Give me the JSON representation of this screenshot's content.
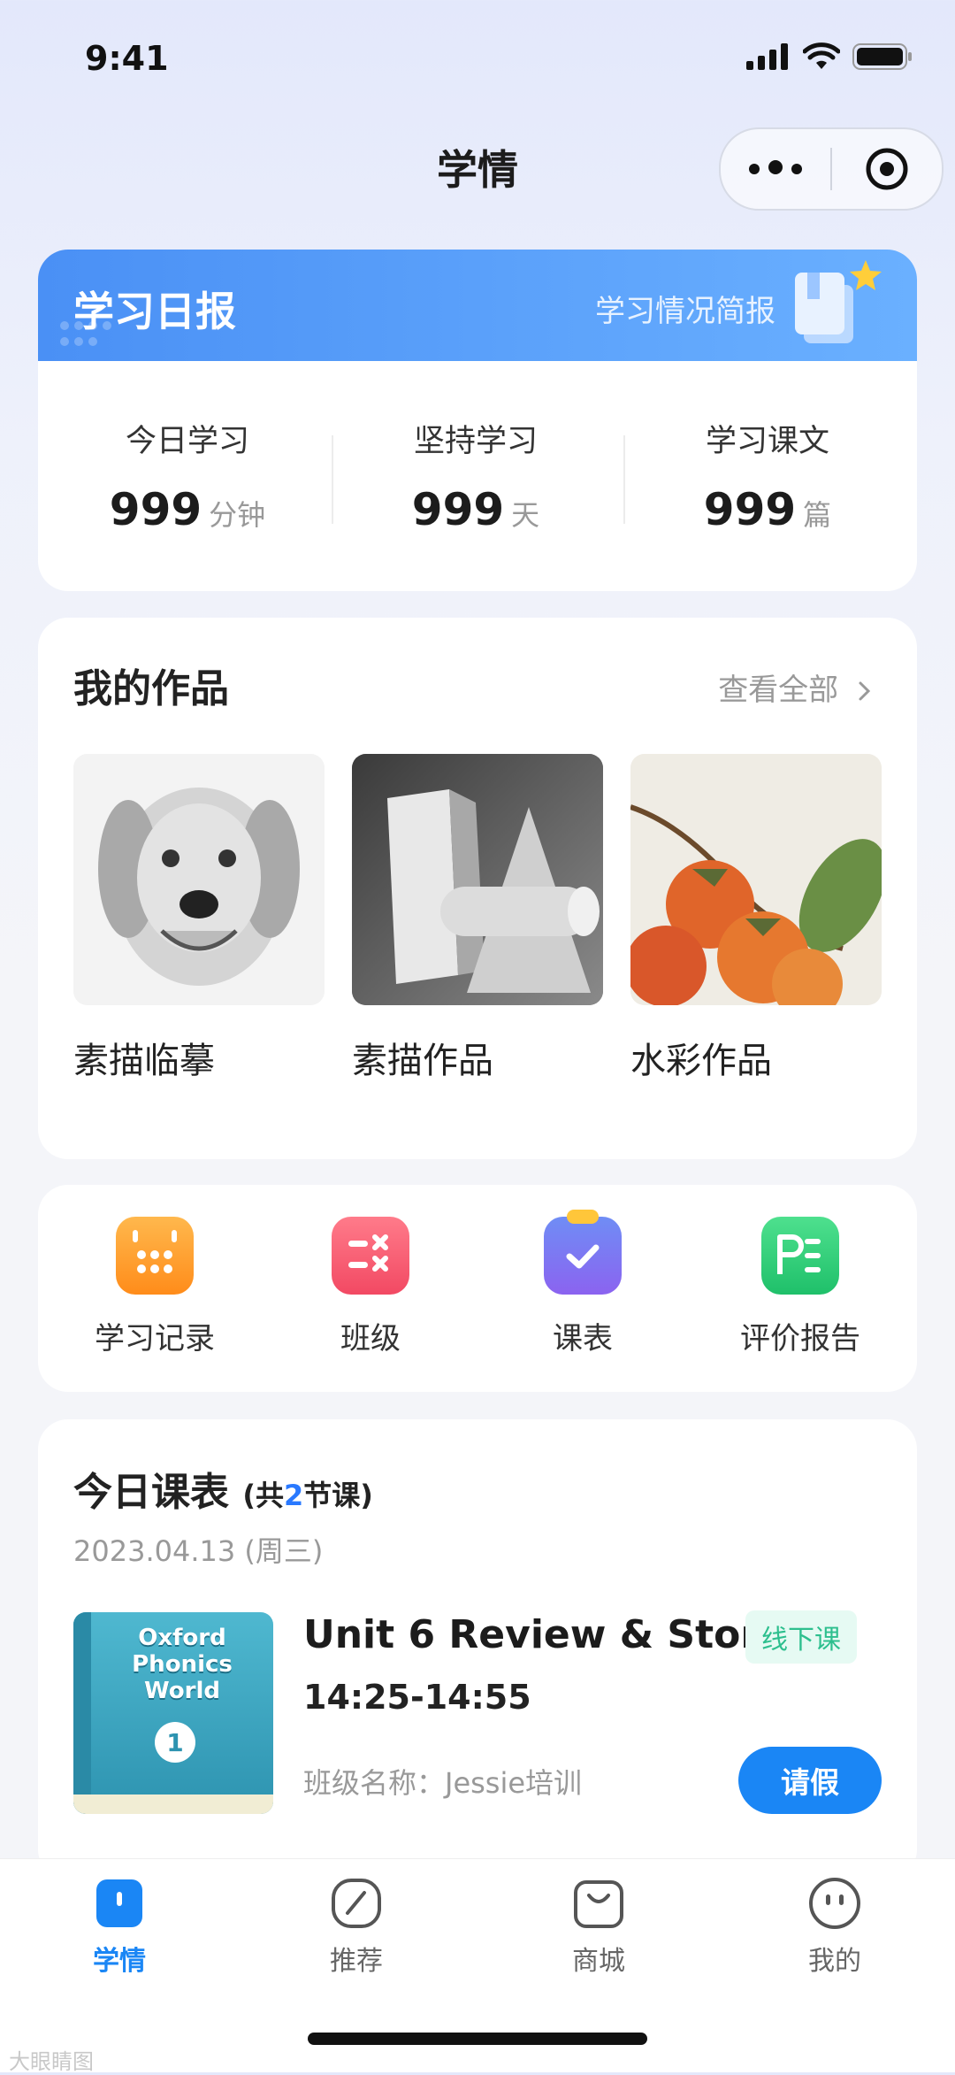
{
  "status_bar": {
    "time": "9:41"
  },
  "nav": {
    "title": "学情"
  },
  "daily_report": {
    "title": "学习日报",
    "subtitle": "学习情况简报",
    "stats": [
      {
        "label": "今日学习",
        "value": "999",
        "unit": "分钟"
      },
      {
        "label": "坚持学习",
        "value": "999",
        "unit": "天"
      },
      {
        "label": "学习课文",
        "value": "999",
        "unit": "篇"
      }
    ]
  },
  "works": {
    "title": "我的作品",
    "see_all": "查看全部",
    "items": [
      {
        "label": "素描临摹"
      },
      {
        "label": "素描作品"
      },
      {
        "label": "水彩作品"
      }
    ]
  },
  "quick_actions": [
    {
      "label": "学习记录",
      "icon": "calendar-icon"
    },
    {
      "label": "班级",
      "icon": "checklist-icon"
    },
    {
      "label": "课表",
      "icon": "clipboard-check-icon"
    },
    {
      "label": "评价报告",
      "icon": "report-icon"
    }
  ],
  "schedule": {
    "title": "今日课表",
    "count_prefix": "(共",
    "count": "2",
    "count_suffix": "节课)",
    "date": "2023.04.13 (周三)",
    "course": {
      "book_text_1": "Oxford",
      "book_text_2": "Phonics",
      "book_text_3": "World",
      "book_number": "1",
      "title": "Unit 6 Review & Story",
      "tag": "线下课",
      "time": "14:25-14:55",
      "class_name": "班级名称：Jessie培训",
      "leave_button": "请假"
    }
  },
  "tab_bar": [
    {
      "label": "学情",
      "icon": "study-icon",
      "active": true
    },
    {
      "label": "推荐",
      "icon": "compass-leaf-icon",
      "active": false
    },
    {
      "label": "商城",
      "icon": "shopping-bag-icon",
      "active": false
    },
    {
      "label": "我的",
      "icon": "smiley-face-icon",
      "active": false
    }
  ],
  "watermark": "大眼睛图",
  "colors": {
    "accent": "#1a86f5",
    "tag_green": "#2dbf8e",
    "header_blue": "#4a90f5"
  }
}
